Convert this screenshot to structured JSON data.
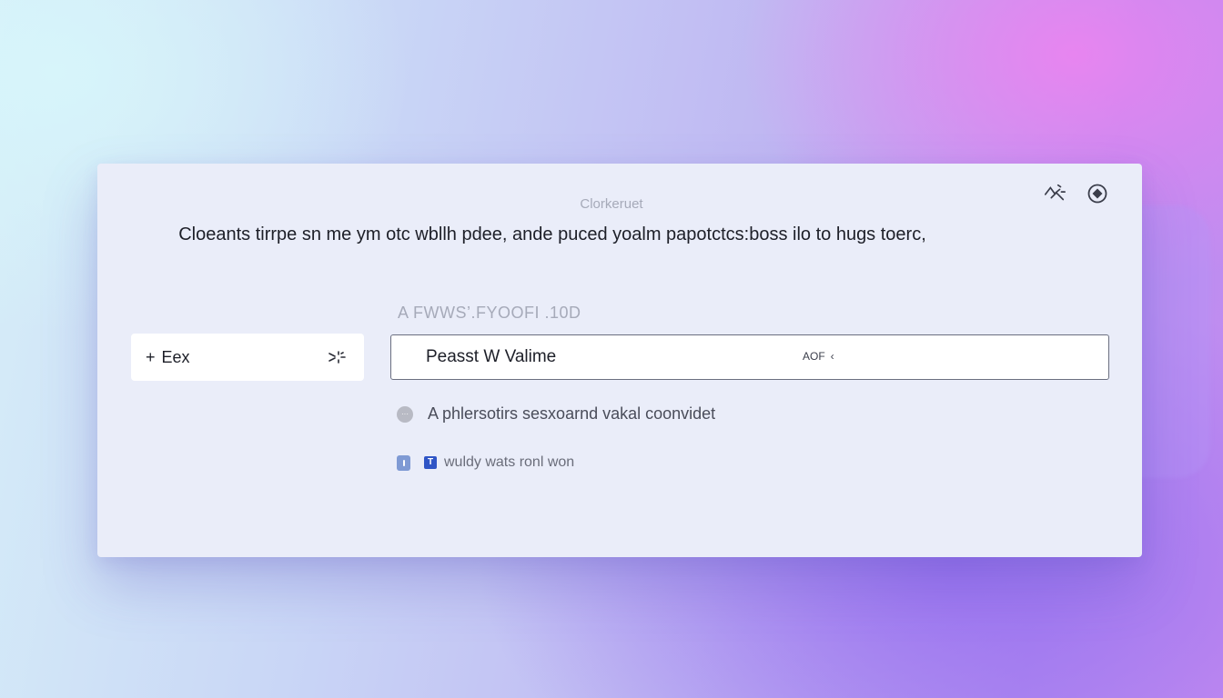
{
  "dialog": {
    "title": "Clorkeruet",
    "subtitle": "Cloeants tirrpe sn me ym otc wbllh pdee, ande puced yoalm papotctcs:boss ilo to hugs toerc,",
    "icons": {
      "settings": "sparkle-settings-icon",
      "preview": "eye-target-icon"
    }
  },
  "left_chip": {
    "plus_symbol": "+",
    "label": "Eex",
    "icon": "sparkle-icon"
  },
  "field": {
    "label": "A FWWS’.FYOOFI .10D",
    "value": "Peasst W Valime",
    "tag_text": "AOF",
    "tag_arrow": "‹"
  },
  "options": [
    {
      "label": "A phlersotirs sesxoarnd  vakal coonvidet",
      "dot": "···"
    },
    {
      "label": "wuldy wats ronl won",
      "checkbox_mark": "T"
    }
  ],
  "colors": {
    "accent": "#2f55c6",
    "toggle": "#7f9ad4",
    "panel": "#eaedf9"
  }
}
